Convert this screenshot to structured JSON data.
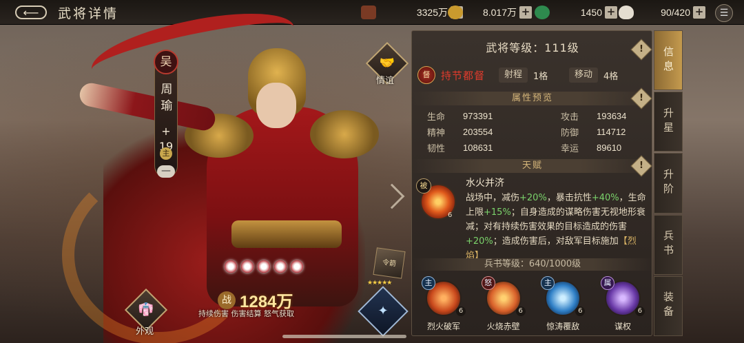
{
  "header": {
    "back_glyph": "⟵",
    "title": "武将详情",
    "resources": [
      {
        "name": "copper",
        "icon": "coin-stack-icon",
        "value": "3325万",
        "color": "#7a3a24"
      },
      {
        "name": "gold",
        "icon": "gold-coin-icon",
        "value": "8.017万",
        "color": "#c99a2e"
      },
      {
        "name": "jade",
        "icon": "jade-icon",
        "value": "1450",
        "color": "#2e8a4e"
      },
      {
        "name": "food",
        "icon": "bun-icon",
        "value": "90/420",
        "color": "#e4ddd0"
      }
    ],
    "plus": "+",
    "menu_glyph": "☰"
  },
  "hero": {
    "faction": "吴",
    "name": "周瑜",
    "plus": "+\n19",
    "lord_badge": "主",
    "minus_badge": "—",
    "orbs": 5,
    "power_label": "战",
    "power": "1284万",
    "power_desc": "持续伤害 伤害结算 怒气获取",
    "stars": "★★★★★"
  },
  "side": {
    "friendship_label": "情谊",
    "appearance_label": "外观",
    "token_label": "令箭"
  },
  "panel": {
    "level_text": "武将等级：111级",
    "rank_emblem": "督",
    "rank_name": "持节都督",
    "range_label": "射程",
    "range_value": "1格",
    "move_label": "移动",
    "move_value": "4格",
    "attr_title": "属性预览",
    "attrs": [
      {
        "k1": "生命",
        "v1": "973391",
        "k2": "攻击",
        "v2": "193634"
      },
      {
        "k1": "精神",
        "v1": "203554",
        "k2": "防御",
        "v2": "114712"
      },
      {
        "k1": "韧性",
        "v1": "108631",
        "k2": "幸运",
        "v2": "89610"
      }
    ],
    "talent_title": "天赋",
    "talent_mark": "被",
    "talent_level": "6",
    "talent_name": "水火并济",
    "talent_desc_parts": [
      "战场中，减伤",
      "+20%",
      "，暴击抗性",
      "+40%",
      "，生命上限",
      "+15%",
      "；自身造成的谋略伤害无视地形衰减；对有持续伤害效果的目标造成的伤害",
      "+20%",
      "；造成伤害后，对敌军目标施加",
      "【烈焰】"
    ],
    "book_level": "兵书等级：640/1000级",
    "skills": [
      {
        "tag": "主",
        "tag_style": "blue",
        "level": "6",
        "name": "烈火破军",
        "color": "#c8481c"
      },
      {
        "tag": "怒",
        "tag_style": "red",
        "level": "6",
        "name": "火烧赤壁",
        "color": "#d8602a"
      },
      {
        "tag": "主",
        "tag_style": "blue",
        "level": "6",
        "name": "惊涛覆敌",
        "color": "#2f7fc6"
      },
      {
        "tag": "属",
        "tag_style": "purple",
        "level": "6",
        "name": "谋权",
        "color": "#6a3aa8"
      }
    ],
    "info_glyph": "!"
  },
  "tabs": [
    "信息",
    "升星",
    "升阶",
    "兵书",
    "装备"
  ],
  "active_tab": 0
}
